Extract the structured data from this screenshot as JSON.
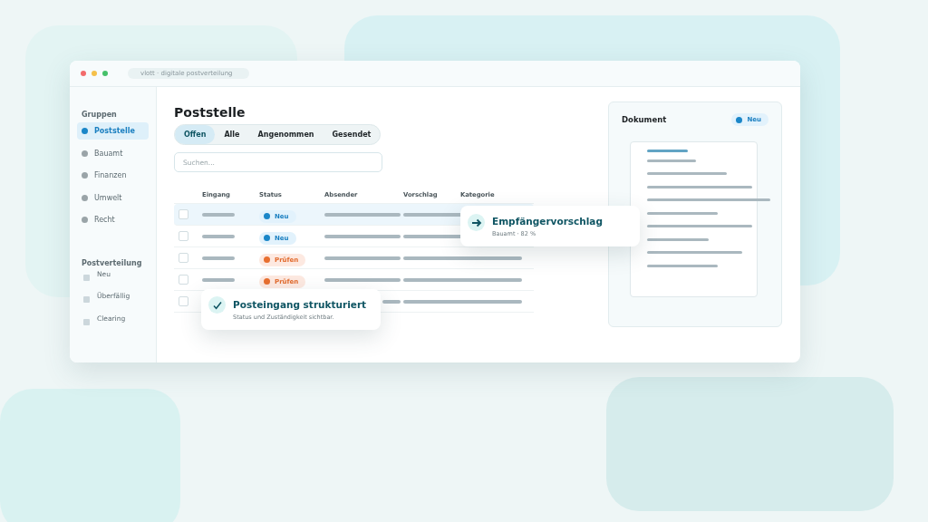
{
  "window": {
    "address": "vlott · digitale postverteilung"
  },
  "sidebar": {
    "groups_heading": "Gruppen",
    "groups": [
      {
        "label": "Poststelle",
        "selected": true
      },
      {
        "label": "Bauamt",
        "selected": false
      },
      {
        "label": "Finanzen",
        "selected": false
      },
      {
        "label": "Umwelt",
        "selected": false
      },
      {
        "label": "Recht",
        "selected": false
      }
    ],
    "distribution_heading": "Postverteilung",
    "distribution": [
      {
        "label": "Neu"
      },
      {
        "label": "Überfällig"
      },
      {
        "label": "Clearing"
      }
    ]
  },
  "main": {
    "title": "Poststelle",
    "tabs": [
      {
        "label": "Offen",
        "selected": true
      },
      {
        "label": "Alle",
        "selected": false
      },
      {
        "label": "Angenommen",
        "selected": false
      },
      {
        "label": "Gesendet",
        "selected": false
      }
    ],
    "search": {
      "placeholder": "Suchen..."
    },
    "table": {
      "columns": [
        "Eingang",
        "Status",
        "Absender",
        "Vorschlag",
        "Kategorie"
      ],
      "rows": [
        {
          "selected": true,
          "checked": false,
          "status": {
            "kind": "new",
            "label": "Neu"
          }
        },
        {
          "selected": false,
          "checked": false,
          "status": {
            "kind": "new",
            "label": "Neu"
          }
        },
        {
          "selected": false,
          "checked": false,
          "status": {
            "kind": "review",
            "label": "Prüfen"
          }
        },
        {
          "selected": false,
          "checked": false,
          "status": {
            "kind": "review",
            "label": "Prüfen"
          }
        },
        {
          "selected": false,
          "checked": false
        }
      ]
    }
  },
  "document": {
    "title": "Dokument",
    "badge": "Neu"
  },
  "suggestion_card": {
    "title": "Empfängervorschlag",
    "subtitle": "Bauamt · 82 %"
  },
  "toast": {
    "title": "Posteingang strukturiert",
    "subtitle": "Status und Zuständigkeit sichtbar."
  }
}
